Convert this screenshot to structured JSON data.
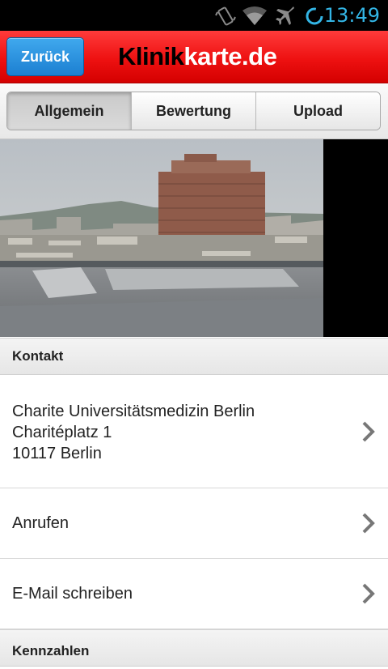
{
  "status_bar": {
    "time": "13:49",
    "icons": [
      "vibrate-icon",
      "wifi-icon",
      "airplane-mode-icon",
      "sync-icon"
    ]
  },
  "header": {
    "back_label": "Zurück",
    "logo_part1": "Klinik",
    "logo_part2": "karte.de",
    "brand_color": "#e60000"
  },
  "tabs": [
    {
      "label": "Allgemein",
      "active": true
    },
    {
      "label": "Bewertung",
      "active": false
    },
    {
      "label": "Upload",
      "active": false
    }
  ],
  "contact": {
    "section_label": "Kontakt",
    "address_line1": "Charite Universitätsmedizin Berlin",
    "address_line2": "Charitéplatz 1",
    "address_line3": "10117 Berlin",
    "call_label": "Anrufen",
    "email_label": "E-Mail schreiben"
  },
  "next_section_label": "Kennzahlen"
}
